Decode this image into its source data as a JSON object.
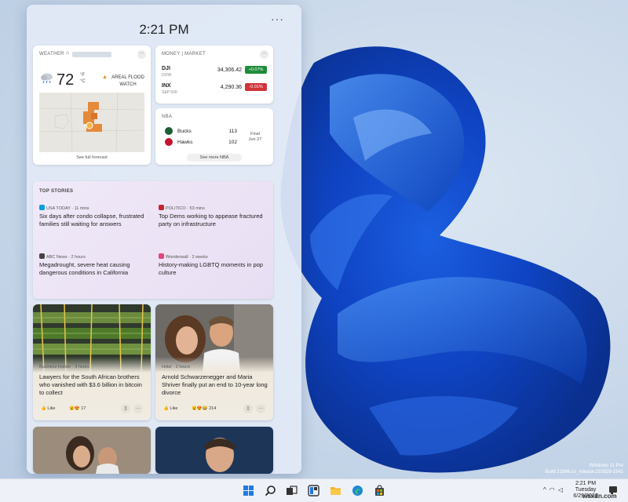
{
  "panel": {
    "time": "2:21 PM",
    "menu_label": "···"
  },
  "weather": {
    "header": "WEATHER",
    "temp": "72",
    "unit_f": "°F",
    "unit_c": "°C",
    "alert": "AREAL FLOOD WATCH",
    "forecast_link": "See full forecast",
    "icon": "cloud-rain-icon"
  },
  "money": {
    "header": "MONEY | MARKET",
    "stocks": [
      {
        "name": "DJI",
        "sub": "DOW",
        "value": "34,306.42",
        "change": "+0.07%",
        "color": "#1e8c3a"
      },
      {
        "name": "INX",
        "sub": "S&P 500",
        "value": "4,290.36",
        "change": "-0.01%",
        "color": "#d13438"
      }
    ]
  },
  "nba": {
    "header": "NBA",
    "teams": [
      {
        "name": "Bucks",
        "score": "113"
      },
      {
        "name": "Hawks",
        "score": "102"
      }
    ],
    "status_line1": "Final",
    "status_line2": "Jun 27",
    "more": "See more NBA"
  },
  "stories": {
    "header": "TOP STORIES",
    "items": [
      {
        "source": "USA TODAY · 11 mins",
        "title": "Six days after condo collapse, frustrated families still waiting for answers",
        "icon_color": "#0a9cdb"
      },
      {
        "source": "POLITICO · 53 mins",
        "title": "Top Dems working to appease fractured party on infrastructure",
        "icon_color": "#c4262e"
      },
      {
        "source": "ABC News · 2 hours",
        "title": "Megadrought, severe heat causing dangerous conditions in California",
        "icon_color": "#444444"
      },
      {
        "source": "Wonderwall · 2 weeks",
        "title": "History-making LGBTQ moments in pop culture",
        "icon_color": "#e0457b"
      }
    ]
  },
  "tiles": [
    {
      "source": "Business Insider · 3 hours",
      "title": "Lawyers for the South African brothers who vanished with $3.6 billion in bitcoin to collect",
      "like": "Like",
      "reactions": "17"
    },
    {
      "source": "Hola! · 2 hours",
      "title": "Arnold Schwarzenegger and Maria Shriver finally put an end to 10-year long divorce",
      "like": "Like",
      "reactions": "214"
    }
  ],
  "watermark": {
    "line1": "Windows 11 Pro",
    "line2": "Build 21996.co_release.210529-1541"
  },
  "taskbar": {
    "time": "2:21 PM",
    "day": "Tuesday",
    "date": "6/29/2021",
    "apps": [
      "start-icon",
      "search-icon",
      "task-view-icon",
      "widgets-icon",
      "file-explorer-icon",
      "edge-icon",
      "store-icon"
    ]
  },
  "site_logo": "wsxdn.com"
}
